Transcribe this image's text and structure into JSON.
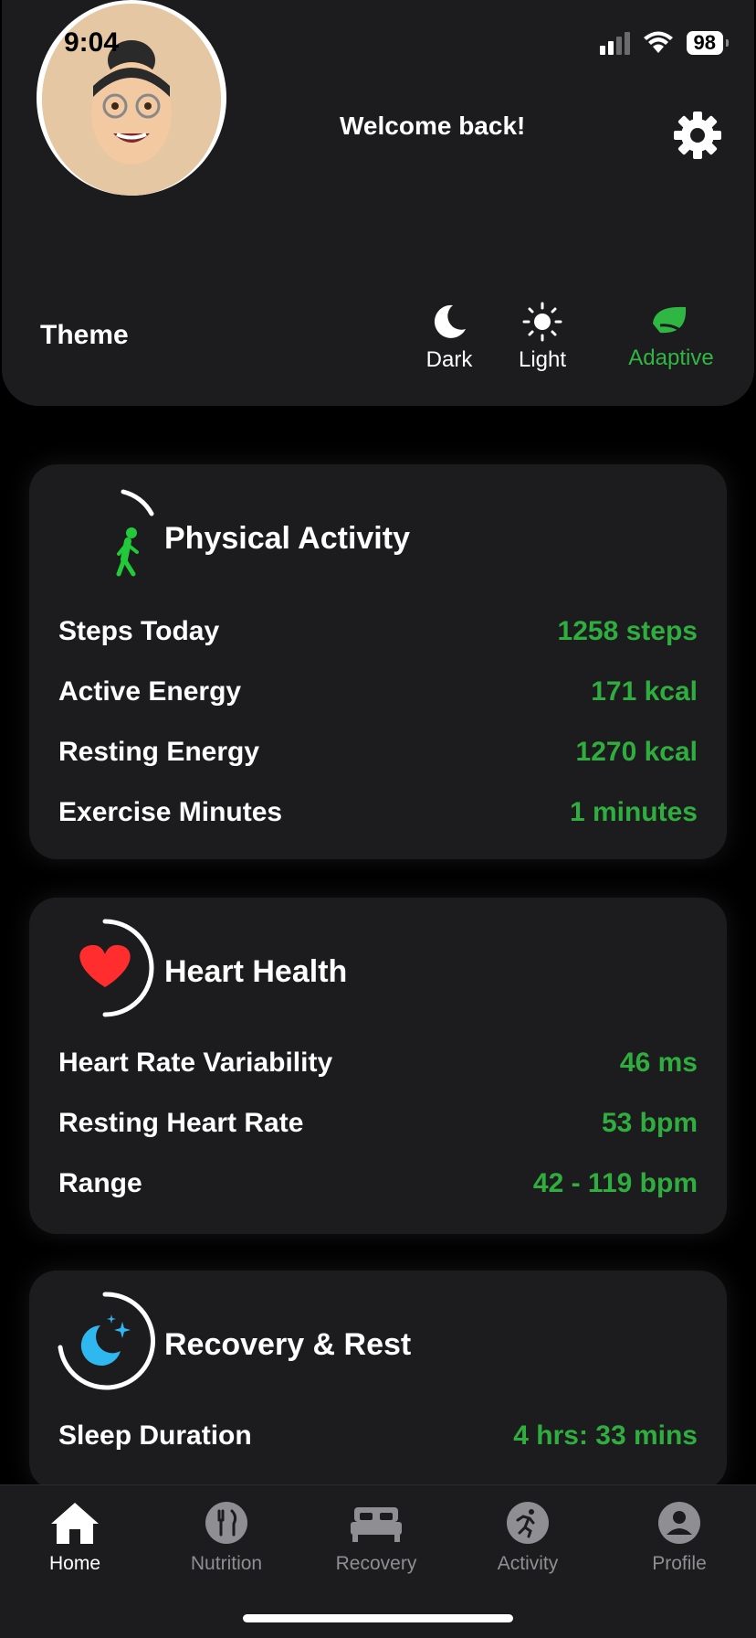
{
  "status_bar": {
    "time": "9:04",
    "battery": "98"
  },
  "header": {
    "welcome": "Welcome back!"
  },
  "theme": {
    "label": "Theme",
    "options": [
      {
        "label": "Dark",
        "icon": "moon-icon"
      },
      {
        "label": "Light",
        "icon": "sun-icon"
      },
      {
        "label": "Adaptive",
        "icon": "leaf-icon",
        "selected": true
      }
    ],
    "accent": "#30b743"
  },
  "physical_activity": {
    "title": "Physical Activity",
    "rows": [
      {
        "label": "Steps Today",
        "value": "1258 steps"
      },
      {
        "label": "Active Energy",
        "value": "171 kcal"
      },
      {
        "label": "Resting Energy",
        "value": "1270 kcal"
      },
      {
        "label": "Exercise Minutes",
        "value": "1 minutes"
      }
    ]
  },
  "heart_health": {
    "title": "Heart Health",
    "rows": [
      {
        "label": "Heart Rate Variability",
        "value": "46 ms"
      },
      {
        "label": "Resting Heart Rate",
        "value": "53 bpm"
      },
      {
        "label": "Range",
        "value": "42 - 119 bpm"
      }
    ]
  },
  "recovery": {
    "title": "Recovery & Rest",
    "rows": [
      {
        "label": "Sleep Duration",
        "value": "4 hrs: 33 mins"
      }
    ]
  },
  "tabs": [
    {
      "label": "Home",
      "active": true
    },
    {
      "label": "Nutrition"
    },
    {
      "label": "Recovery"
    },
    {
      "label": "Activity"
    },
    {
      "label": "Profile"
    }
  ],
  "colors": {
    "value_green": "#2fae3f",
    "card_bg": "#1c1c1e",
    "heart_red": "#ff2d2d",
    "moon_blue": "#2fb7f0"
  }
}
